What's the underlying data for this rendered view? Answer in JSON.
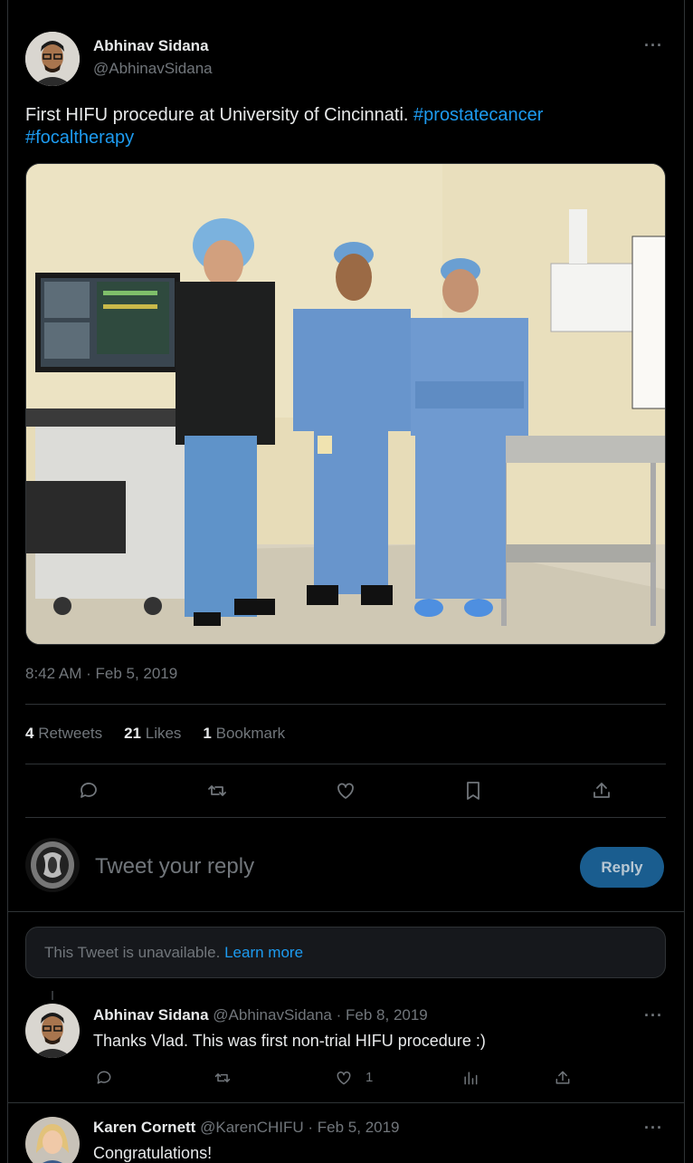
{
  "main_tweet": {
    "author_name": "Abhinav Sidana",
    "author_handle": "@AbhinavSidana",
    "more_label": "···",
    "text": "First HIFU procedure at University of Cincinnati.",
    "hashtags": [
      "#prostatecancer",
      "#focaltherapy"
    ],
    "timestamp": "8:42 AM · Feb 5, 2019",
    "stats": {
      "retweets_count": "4",
      "retweets_label": "Retweets",
      "likes_count": "21",
      "likes_label": "Likes",
      "bookmarks_count": "1",
      "bookmarks_label": "Bookmark"
    },
    "actions": [
      "reply-icon",
      "retweet-icon",
      "like-icon",
      "bookmark-icon",
      "share-icon"
    ]
  },
  "reply_composer": {
    "placeholder": "Tweet your reply",
    "button_label": "Reply"
  },
  "unavailable_notice": {
    "text": "This Tweet is unavailable.",
    "link": "Learn more"
  },
  "replies": [
    {
      "author_name": "Abhinav Sidana",
      "author_handle": "@AbhinavSidana",
      "date": "· Feb 8, 2019",
      "text": "Thanks Vlad. This was first non-trial HIFU procedure :)",
      "like_count": "1",
      "more_label": "···"
    },
    {
      "author_name": "Karen Cornett",
      "author_handle": "@KarenCHIFU",
      "date": "· Feb 5, 2019",
      "text": "Congratulations!",
      "more_label": "···"
    }
  ],
  "colors": {
    "background": "#000000",
    "link": "#1d9bf0",
    "muted": "#71767b",
    "divider": "#2f3336",
    "reply_button": "#1a5d8f"
  }
}
